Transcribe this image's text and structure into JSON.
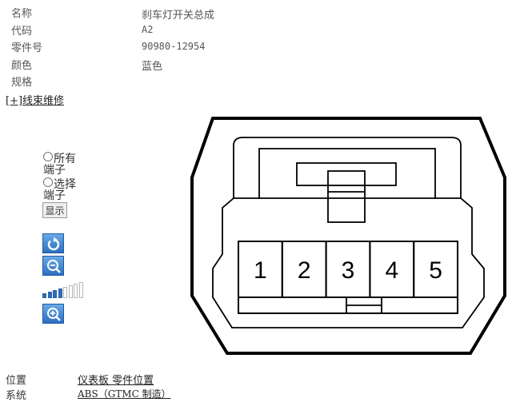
{
  "info": {
    "rows": [
      {
        "label": "名称",
        "value": "刹车灯开关总成"
      },
      {
        "label": "代码",
        "value": "A2"
      },
      {
        "label": "零件号",
        "value": "90980-12954"
      },
      {
        "label": "颜色",
        "value": "蓝色"
      },
      {
        "label": "规格",
        "value": ""
      }
    ]
  },
  "harness_link": "[+]线束维修",
  "controls": {
    "radio_all": "所有端子",
    "radio_select": "选择端子",
    "show_button": "显示",
    "zoom_level": {
      "filled": 4,
      "total": 8
    }
  },
  "connector": {
    "pins": [
      "1",
      "2",
      "3",
      "4",
      "5"
    ]
  },
  "footer": {
    "position_label": "位置",
    "position_value": "仪表板  零件位置",
    "system_label": "系统",
    "system_value": "ABS（GTMC 制造）"
  },
  "colors": {
    "accent_blue": "#2c6fc0",
    "line": "#000000"
  }
}
